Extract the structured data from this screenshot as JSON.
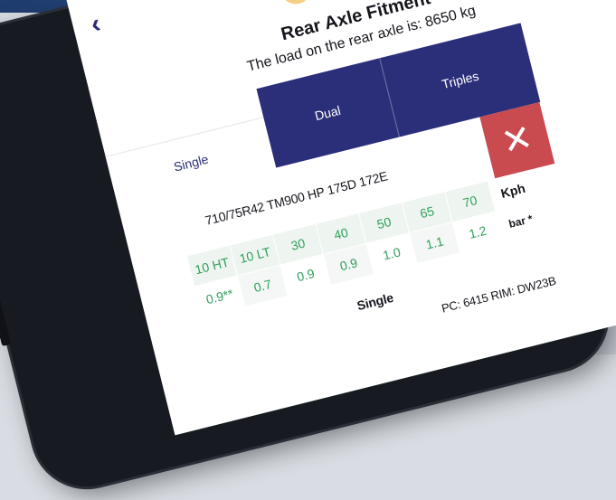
{
  "colors": {
    "navy": "#2b2f79",
    "close_red": "#c94a4f",
    "alert_yellow": "#f6cf86",
    "alert_blue": "#2a7fbd",
    "green_text": "#2fa05a"
  },
  "header": {
    "back_icon": "chevron-left-icon",
    "status_icons": [
      {
        "icon": "warning-icon",
        "glyph": "!"
      },
      {
        "icon": "info-icon",
        "glyph": "!"
      },
      {
        "icon": "help-icon",
        "glyph": "?"
      }
    ]
  },
  "title": "Rear Axle Fitment",
  "load_text": "The load on the rear axle is: 8650 kg",
  "tabs": [
    {
      "label": "Single",
      "selected": true
    },
    {
      "label": "Dual",
      "selected": false
    },
    {
      "label": "Triples",
      "selected": false
    }
  ],
  "close_icon": "close-icon",
  "tyre_spec": "710/75R42 TM900 HP 175D 172E",
  "table": {
    "speed_unit": "Kph",
    "pressure_unit": "bar *",
    "speeds": [
      "10 HT",
      "10 LT",
      "30",
      "40",
      "50",
      "65",
      "70"
    ],
    "pressures": [
      "0.9**",
      "0.7",
      "0.9",
      "0.9",
      "1.0",
      "1.1",
      "1.2"
    ]
  },
  "config_label": "Single",
  "config_detail": "PC: 6415 RIM: DW23B"
}
